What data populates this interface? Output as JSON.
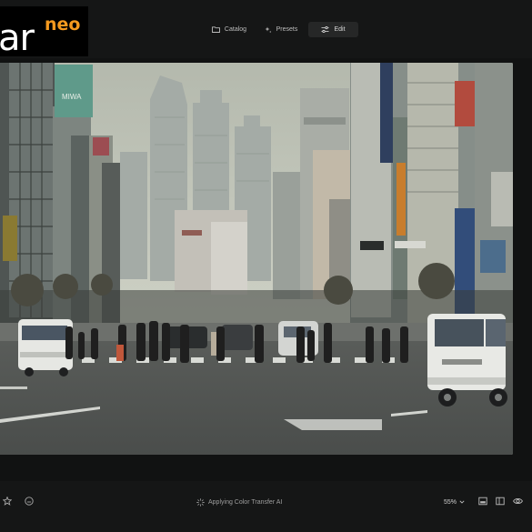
{
  "app": {
    "logo_text": "ar",
    "logo_accent": "neo",
    "accent_color": "#f59a1f"
  },
  "tabs": [
    {
      "label": "Catalog",
      "icon": "folder-icon",
      "active": false
    },
    {
      "label": "Presets",
      "icon": "sparkle-icon",
      "active": false
    },
    {
      "label": "Edit",
      "icon": "sliders-icon",
      "active": true
    }
  ],
  "photo": {
    "subject": "street-crossing-photo",
    "signs": [
      "MIWA"
    ]
  },
  "bottombar": {
    "status_text": "Applying Color Transfer AI",
    "zoom_value": "55%",
    "icons": [
      "star-icon",
      "smiley-icon",
      "compare-icon",
      "split-view-icon",
      "eye-icon"
    ]
  }
}
